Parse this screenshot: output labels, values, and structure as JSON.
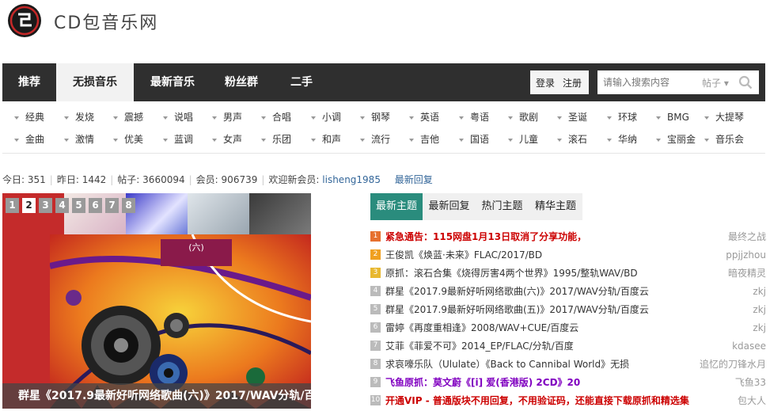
{
  "site": {
    "name": "CD包音乐网"
  },
  "nav": {
    "items": [
      "推荐",
      "无损音乐",
      "最新音乐",
      "粉丝群",
      "二手"
    ],
    "login": "登录",
    "register": "注册",
    "search_placeholder": "请输入搜索内容",
    "search_scope": "帖子"
  },
  "genres": {
    "row1": [
      "经典",
      "发烧",
      "震撼",
      "说唱",
      "男声",
      "合唱",
      "小调",
      "钢琴",
      "英语",
      "粤语",
      "歌剧",
      "圣诞",
      "环球",
      "BMG",
      "大提琴"
    ],
    "row2": [
      "金曲",
      "激情",
      "优美",
      "蓝调",
      "女声",
      "乐团",
      "和声",
      "流行",
      "吉他",
      "国语",
      "儿童",
      "滚石",
      "华纳",
      "宝丽金",
      "音乐会"
    ]
  },
  "stats": {
    "today_label": "今日:",
    "today": "351",
    "yesterday_label": "昨日:",
    "yesterday": "1442",
    "posts_label": "帖子:",
    "posts": "3660094",
    "members_label": "会员:",
    "members": "906739",
    "welcome_label": "欢迎新会员:",
    "new_member": "lisheng1985",
    "latest_reply": "最新回复"
  },
  "slider": {
    "pages": [
      "1",
      "2",
      "3",
      "4",
      "5",
      "6",
      "7",
      "8"
    ],
    "active_page": 2,
    "caption": "群星《2017.9最新好听网络歌曲(六)》2017/WAV分轨/百度云",
    "art_label": "(六)"
  },
  "topic_tabs": [
    "最新主题",
    "最新回复",
    "热门主题",
    "精华主题"
  ],
  "topics": [
    {
      "rank": "1",
      "title": "紧急通告：115网盘1月13日取消了分享功能，",
      "author": "最终之战",
      "style": "red"
    },
    {
      "rank": "2",
      "title": "王俊凯《焕蓝·未来》FLAC/2017/BD",
      "author": "ppjjzhou",
      "style": "normal"
    },
    {
      "rank": "3",
      "title": "原抓：滚石合集《烧得厉害4两个世界》1995/整轨WAV/BD",
      "author": "暗夜精灵",
      "style": "normal"
    },
    {
      "rank": "4",
      "title": "群星《2017.9最新好听网络歌曲(六)》2017/WAV分轨/百度云",
      "author": "zkj",
      "style": "normal"
    },
    {
      "rank": "5",
      "title": "群星《2017.9最新好听网络歌曲(五)》2017/WAV分轨/百度云",
      "author": "zkj",
      "style": "normal"
    },
    {
      "rank": "6",
      "title": "雷婷《再度重相逢》2008/WAV+CUE/百度云",
      "author": "zkj",
      "style": "normal"
    },
    {
      "rank": "7",
      "title": "艾菲《菲爱不可》2014_EP/FLAC/分轨/百度",
      "author": "kdasee",
      "style": "normal"
    },
    {
      "rank": "8",
      "title": "求哀嚎乐队（Ululate）《Back to Cannibal World》无损",
      "author": "追忆的刀锋水月",
      "style": "normal"
    },
    {
      "rank": "9",
      "title": "飞鱼原抓：莫文蔚《[i] 爱(香港版) 2CD》20",
      "author": "飞鱼33",
      "style": "purple"
    },
    {
      "rank": "10",
      "title": "开通VIP - 普通版块不用回复，不用验证码，还能直接下载原抓和精选集",
      "author": "包大人",
      "style": "red"
    }
  ],
  "colors": {
    "nav_bg": "#2f2f2f",
    "tab_active": "#2a8c7d",
    "rank_top": "#e6702e",
    "rank_high": "#f0a020",
    "rank_mid": "#e8b830",
    "rank_normal": "#bbbbbb",
    "link_red": "#cc0000",
    "link_purple": "#8000c0",
    "link_blue": "#336699"
  }
}
